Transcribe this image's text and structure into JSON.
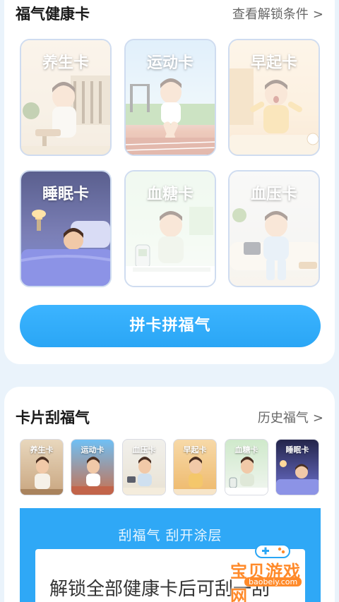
{
  "health_section": {
    "title": "福气健康卡",
    "link": "查看解锁条件",
    "link_chevron": ">",
    "cards": [
      {
        "label": "养生卡",
        "icon": "tea-relax-illustration"
      },
      {
        "label": "运动卡",
        "icon": "running-illustration"
      },
      {
        "label": "早起卡",
        "icon": "wake-up-illustration"
      },
      {
        "label": "睡眠卡",
        "icon": "sleeping-illustration"
      },
      {
        "label": "血糖卡",
        "icon": "glucose-meter-illustration"
      },
      {
        "label": "血压卡",
        "icon": "blood-pressure-illustration"
      }
    ],
    "cta_label": "拼卡拼福气"
  },
  "scratch_section": {
    "title": "卡片刮福气",
    "link": "历史福气",
    "link_chevron": ">",
    "thumbnails": [
      {
        "label": "养生卡"
      },
      {
        "label": "运动卡"
      },
      {
        "label": "血压卡"
      },
      {
        "label": "早起卡"
      },
      {
        "label": "血糖卡"
      },
      {
        "label": "睡眠卡"
      }
    ],
    "scratch_title": "刮福气  刮开涂层",
    "scratch_text": "解锁全部健康卡后可刮一刮"
  },
  "watermark": {
    "text": "宝贝游戏网",
    "url": "baobeiy.com"
  },
  "colors": {
    "accent": "#2aa6f5",
    "watermark": "#ff8a2a"
  }
}
